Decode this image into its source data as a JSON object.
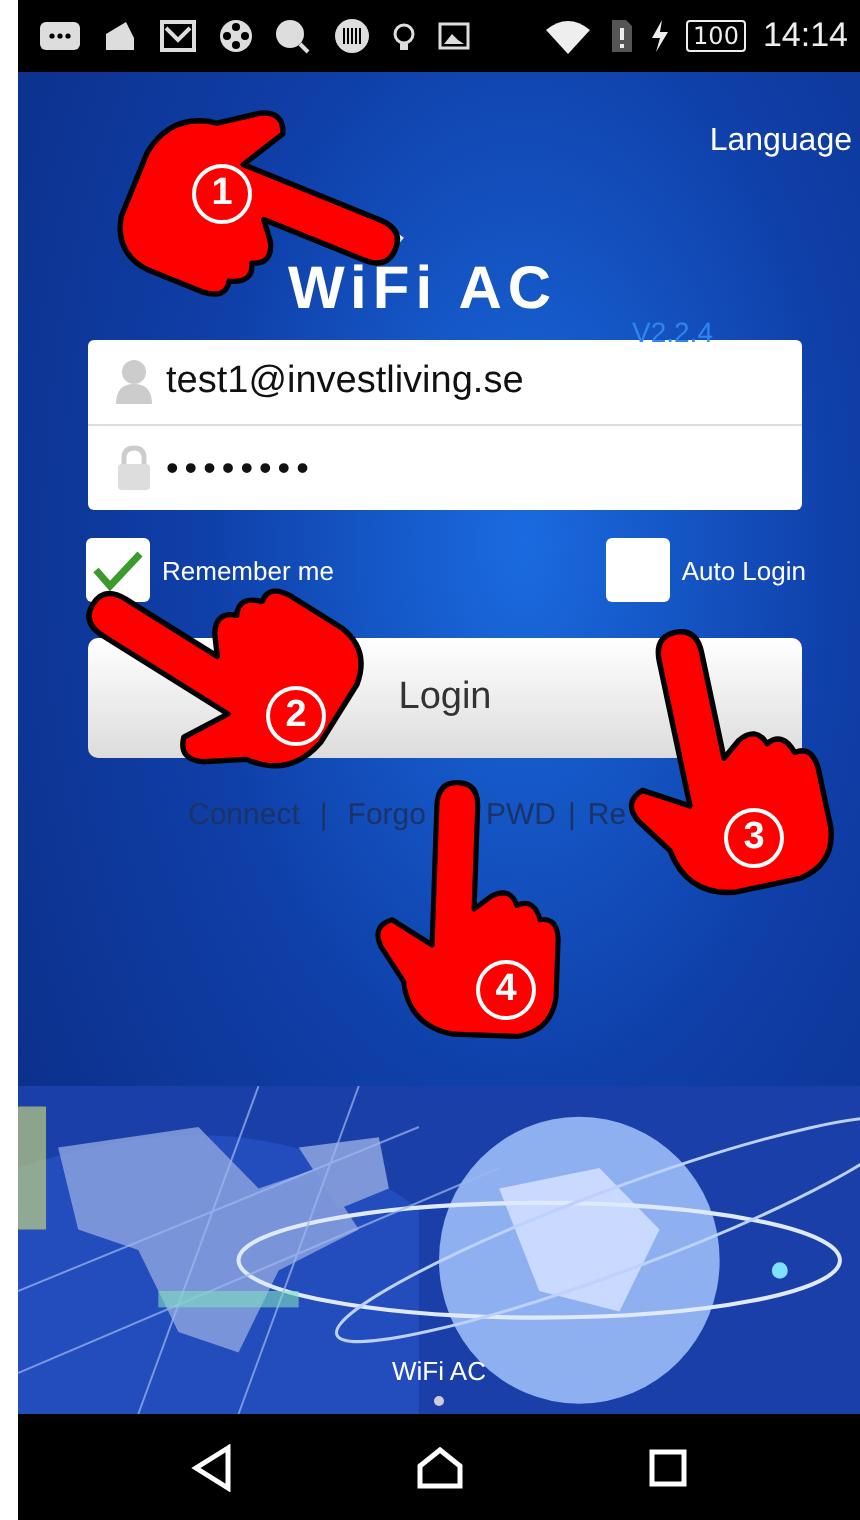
{
  "status_bar": {
    "battery": "100",
    "time": "14:14"
  },
  "language": "Language",
  "app_title": "WiFi AC",
  "version": "V2.2.4",
  "login_form": {
    "username": "test1@investliving.se",
    "password": "••••••••"
  },
  "options": [
    {
      "label": "Remember me",
      "checked": true
    },
    {
      "label": "Auto Login",
      "checked": false
    }
  ],
  "login_button": "Login",
  "links": [
    "Connect",
    "|",
    "Forgo",
    "PWD",
    "|",
    "Re"
  ],
  "banner": {
    "caption": "WiFi AC"
  },
  "annotations": [
    {
      "number": "1"
    },
    {
      "number": "2"
    },
    {
      "number": "3"
    },
    {
      "number": "4"
    }
  ]
}
